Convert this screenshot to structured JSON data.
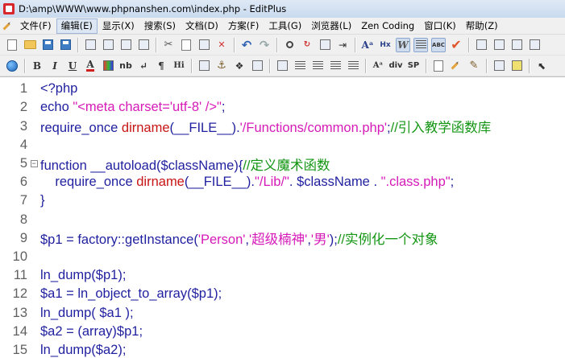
{
  "window": {
    "title": "D:\\amp\\WWW\\www.phpnanshen.com\\index.php - EditPlus"
  },
  "menu": {
    "items": [
      {
        "label": "文件(F)"
      },
      {
        "label": "编辑(E)"
      },
      {
        "label": "显示(X)"
      },
      {
        "label": "搜索(S)"
      },
      {
        "label": "文档(D)"
      },
      {
        "label": "方案(F)"
      },
      {
        "label": "工具(G)"
      },
      {
        "label": "浏览器(L)"
      },
      {
        "label": "Zen Coding"
      },
      {
        "label": "窗口(K)"
      },
      {
        "label": "帮助(Z)"
      }
    ]
  },
  "toolbar2": {
    "bold": "B",
    "italic": "I",
    "underline": "U",
    "font_color": "A",
    "nb": "nb",
    "br": "↵",
    "paragraph": "¶",
    "heading": "Hi",
    "font_size": "Aᵃ",
    "div": "div",
    "sp": "SP",
    "hx": "Hx",
    "w": "W",
    "abc": "ABC"
  },
  "editor": {
    "lines": [
      {
        "n": "1",
        "tokens": [
          [
            "k",
            "<?php"
          ]
        ]
      },
      {
        "n": "2",
        "tokens": [
          [
            "k",
            "echo "
          ],
          [
            "s",
            "\"<meta charset='utf-8' />\""
          ],
          [
            "k",
            ";"
          ]
        ]
      },
      {
        "n": "3",
        "tokens": [
          [
            "k",
            "require_once "
          ],
          [
            "f",
            "dirname"
          ],
          [
            "k",
            "(__FILE__)."
          ],
          [
            "s",
            "'/Functions/common.php'"
          ],
          [
            "k",
            ";"
          ],
          [
            "c",
            "//引入教学函数库"
          ]
        ]
      },
      {
        "n": "4",
        "tokens": []
      },
      {
        "n": "5",
        "fold": "−",
        "tokens": [
          [
            "k",
            "function __autoload("
          ],
          [
            "v",
            "$className"
          ],
          [
            "k",
            "){"
          ],
          [
            "c",
            "//定义魔术函数"
          ]
        ]
      },
      {
        "n": "6",
        "tokens": [
          [
            "k",
            "    require_once "
          ],
          [
            "f",
            "dirname"
          ],
          [
            "k",
            "(__FILE__)."
          ],
          [
            "s",
            "\"/Lib/\""
          ],
          [
            "k",
            ". "
          ],
          [
            "v",
            "$className"
          ],
          [
            "k",
            " . "
          ],
          [
            "s",
            "\".class.php\""
          ],
          [
            "k",
            ";"
          ]
        ]
      },
      {
        "n": "7",
        "tokens": [
          [
            "k",
            "}"
          ]
        ]
      },
      {
        "n": "8",
        "tokens": []
      },
      {
        "n": "9",
        "tokens": [
          [
            "v",
            "$p1"
          ],
          [
            "k",
            " = factory::getInstance("
          ],
          [
            "s",
            "'Person'"
          ],
          [
            "k",
            ","
          ],
          [
            "s",
            "'超级楠神'"
          ],
          [
            "k",
            ","
          ],
          [
            "s",
            "'男'"
          ],
          [
            "k",
            ");"
          ],
          [
            "c",
            "//实例化一个对象"
          ]
        ]
      },
      {
        "n": "10",
        "tokens": []
      },
      {
        "n": "11",
        "tokens": [
          [
            "k",
            "ln_dump("
          ],
          [
            "v",
            "$p1"
          ],
          [
            "k",
            ");"
          ]
        ]
      },
      {
        "n": "12",
        "tokens": [
          [
            "v",
            "$a1"
          ],
          [
            "k",
            " = ln_object_to_array("
          ],
          [
            "v",
            "$p1"
          ],
          [
            "k",
            ");"
          ]
        ]
      },
      {
        "n": "13",
        "tokens": [
          [
            "k",
            "ln_dump( "
          ],
          [
            "v",
            "$a1"
          ],
          [
            "k",
            " );"
          ]
        ]
      },
      {
        "n": "14",
        "tokens": [
          [
            "v",
            "$a2"
          ],
          [
            "k",
            " = (array)"
          ],
          [
            "v",
            "$p1"
          ],
          [
            "k",
            ";"
          ]
        ]
      },
      {
        "n": "15",
        "tokens": [
          [
            "k",
            "ln_dump("
          ],
          [
            "v",
            "$a2"
          ],
          [
            "k",
            ");"
          ]
        ]
      }
    ]
  }
}
